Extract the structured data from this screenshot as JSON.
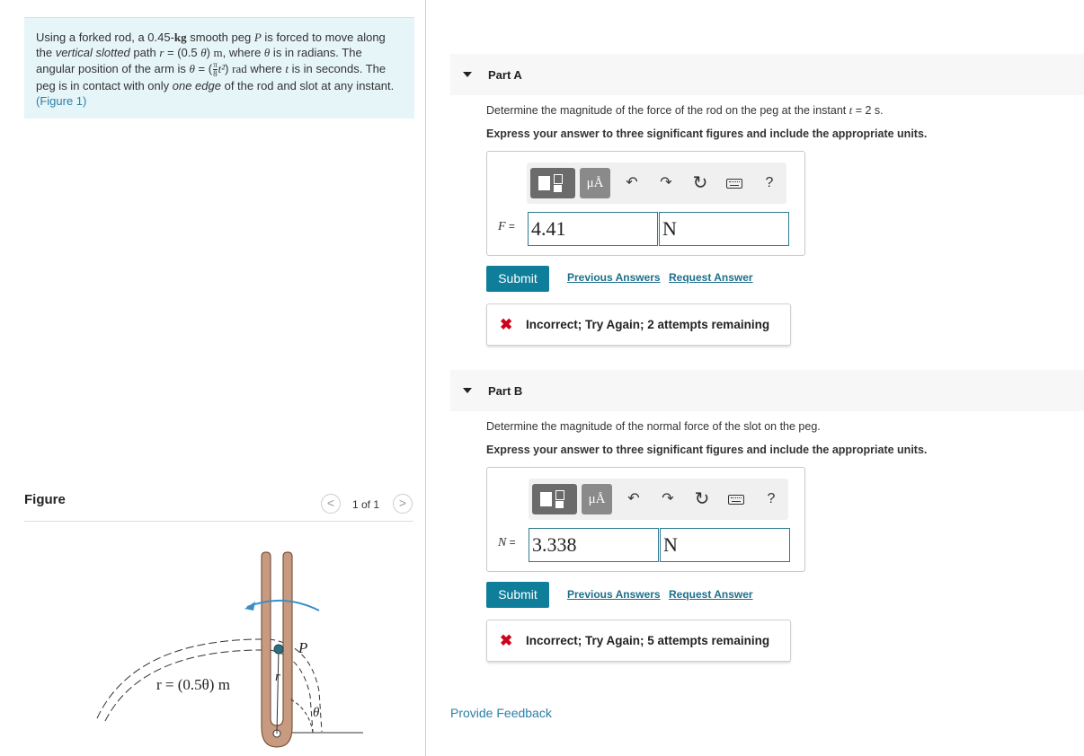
{
  "problem": {
    "t1": "Using a forked rod, a 0.45-",
    "kg": "kg",
    "t2": " smooth peg ",
    "P": "P",
    "t3": " is forced to move along the ",
    "vsp": "vertical slotted",
    "t4": " path ",
    "r": "r",
    "t5": " = (0.5 ",
    "theta": "θ",
    "t6": ") ",
    "m": "m",
    "t7": ", where ",
    "t8": " is in radians. The angular position of the arm is ",
    "t9": " = (",
    "pi": "π",
    "eight": "8",
    "t10": "t²",
    "t11": ") ",
    "rad": "rad",
    "t12": " where ",
    "t_var": "t",
    "t13": " is in seconds. The peg is in contact with only ",
    "one_edge": "one edge",
    "t14": " of the rod and slot at any instant. ",
    "figure_link": "(Figure 1)"
  },
  "figure": {
    "title": "Figure",
    "count": "1 of 1",
    "prev": "<",
    "next": ">",
    "label_P": "P",
    "label_r": "r",
    "label_path": "r = (0.5θ) m",
    "label_theta": "θ"
  },
  "partA": {
    "label": "Part A",
    "q1": "Determine the magnitude of the force of the rod on the peg at the instant ",
    "q_t": "t",
    "q2": " = 2 s.",
    "instr": "Express your answer to three significant figures and include the appropriate units.",
    "var": "F",
    "eq": " =",
    "value": "4.41",
    "unit": "N",
    "submit": "Submit",
    "prev_answers": "Previous Answers",
    "request_answer": "Request Answer",
    "feedback": "Incorrect; Try Again; 2 attempts remaining"
  },
  "partB": {
    "label": "Part B",
    "question": "Determine the magnitude of the normal force of the slot on the peg.",
    "instr": "Express your answer to three significant figures and include the appropriate units.",
    "var": "N",
    "eq": " =",
    "value": "3.338",
    "unit": "N",
    "submit": "Submit",
    "prev_answers": "Previous Answers",
    "request_answer": "Request Answer",
    "feedback": "Incorrect; Try Again; 5 attempts remaining"
  },
  "toolbar": {
    "units_label": "μÅ",
    "help": "?",
    "undo": "↶",
    "redo": "↷",
    "reset": "↻"
  },
  "icons": {
    "x_mark": "✖"
  },
  "provide_feedback": "Provide Feedback",
  "colors": {
    "accent": "#0f7e9b",
    "error": "#d0021b",
    "problem_bg": "#e6f5f8",
    "rod": "#c89b80"
  }
}
